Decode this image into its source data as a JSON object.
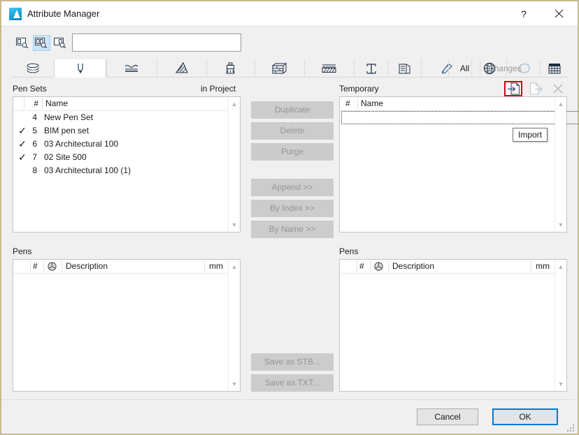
{
  "window": {
    "title": "Attribute Manager",
    "app_icon": "archicad-icon",
    "help_button": "?",
    "close_button": "close-icon"
  },
  "search": {
    "value": "",
    "placeholder": "",
    "scope_buttons": [
      {
        "name": "search-scope-name-icon",
        "active": false
      },
      {
        "name": "search-scope-all-icon",
        "active": true
      },
      {
        "name": "search-scope-index-icon",
        "active": false
      }
    ]
  },
  "tabs": [
    {
      "name": "tab-building-materials",
      "icon": "layers-icon",
      "selected": false
    },
    {
      "name": "tab-pens-and-colors",
      "icon": "pen-icon",
      "selected": true
    },
    {
      "name": "tab-line-types",
      "icon": "line-types-icon",
      "selected": false
    },
    {
      "name": "tab-fills",
      "icon": "fill-hatch-icon",
      "selected": false
    },
    {
      "name": "tab-surfaces",
      "icon": "paint-brush-icon",
      "selected": false
    },
    {
      "name": "tab-composites",
      "icon": "brick-wall-icon",
      "selected": false
    },
    {
      "name": "tab-layer-combinations",
      "icon": "stacked-hatch-icon",
      "selected": false
    },
    {
      "name": "tab-profiles",
      "icon": "i-beam-icon",
      "selected": false
    },
    {
      "name": "tab-zone-categories",
      "icon": "zone-icon",
      "selected": false
    },
    {
      "name": "tab-mep-systems",
      "icon": "pen-signature-icon",
      "selected": false
    },
    {
      "name": "tab-operation-profiles",
      "icon": "globe-icon",
      "selected": false
    },
    {
      "name": "tab-markup-styles",
      "icon": "cloud-polygon-icon",
      "selected": false
    },
    {
      "name": "tab-grid-types",
      "icon": "grid-icon",
      "selected": false
    }
  ],
  "filter_tabs": [
    {
      "label": "All",
      "active": true
    },
    {
      "label": "Changes",
      "active": false
    }
  ],
  "left_panel": {
    "title": "Pen Sets",
    "source_label": "in Project",
    "columns": [
      {
        "key": "check",
        "label": ""
      },
      {
        "key": "num",
        "label": "#"
      },
      {
        "key": "name",
        "label": "Name"
      }
    ],
    "rows": [
      {
        "checked": false,
        "num": "4",
        "name": "New Pen Set"
      },
      {
        "checked": true,
        "num": "5",
        "name": "BIM pen set"
      },
      {
        "checked": true,
        "num": "6",
        "name": "03 Architectural 100"
      },
      {
        "checked": true,
        "num": "7",
        "name": "02 Site 500"
      },
      {
        "checked": false,
        "num": "8",
        "name": "03 Architectural 100 (1)"
      }
    ],
    "check_glyph": "✓",
    "pens": {
      "title": "Pens",
      "columns": [
        {
          "key": "num",
          "label": "#"
        },
        {
          "key": "swatch",
          "label": "color-wheel-icon"
        },
        {
          "key": "description",
          "label": "Description"
        },
        {
          "key": "mm",
          "label": "mm"
        }
      ],
      "rows": []
    }
  },
  "right_panel": {
    "title": "Temporary",
    "toolbar": [
      {
        "name": "import-button",
        "icon": "import-file-icon",
        "enabled": true,
        "highlighted": true
      },
      {
        "name": "export-button",
        "icon": "export-file-icon",
        "enabled": false,
        "highlighted": false
      },
      {
        "name": "close-file-button",
        "icon": "close-x-icon",
        "enabled": false,
        "highlighted": false
      }
    ],
    "tooltip": "Import",
    "columns": [
      {
        "key": "num",
        "label": "#"
      },
      {
        "key": "name",
        "label": "Name"
      }
    ],
    "rows": [],
    "pens": {
      "title": "Pens",
      "columns": [
        {
          "key": "num",
          "label": "#"
        },
        {
          "key": "swatch",
          "label": "color-wheel-icon"
        },
        {
          "key": "description",
          "label": "Description"
        },
        {
          "key": "mm",
          "label": "mm"
        }
      ],
      "rows": []
    }
  },
  "mid_buttons": [
    {
      "name": "duplicate-button",
      "label": "Duplicate",
      "enabled": false
    },
    {
      "name": "delete-button",
      "label": "Delete",
      "enabled": false
    },
    {
      "name": "purge-button",
      "label": "Purge",
      "enabled": false
    },
    {
      "name": "append-button",
      "label": "Append >>",
      "enabled": false
    },
    {
      "name": "by-index-button",
      "label": "By Index >>",
      "enabled": false
    },
    {
      "name": "by-name-button",
      "label": "By Name >>",
      "enabled": false
    },
    {
      "name": "save-as-stb-button",
      "label": "Save as STB...",
      "enabled": false
    },
    {
      "name": "save-as-txt-button",
      "label": "Save as TXT...",
      "enabled": false
    }
  ],
  "footer": {
    "cancel_label": "Cancel",
    "ok_label": "OK"
  },
  "colors": {
    "window_border": "#c9b98f",
    "dialog_bg": "#f0f0f0",
    "accent": "#0078d7",
    "highlight_red": "#d0021b",
    "scope_active": "#cce4f7",
    "disabled_text": "#959595"
  }
}
